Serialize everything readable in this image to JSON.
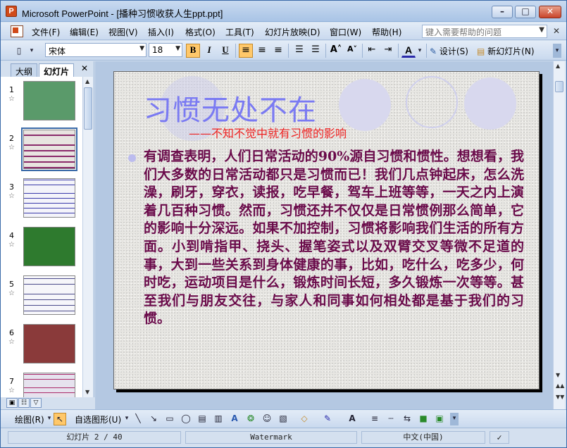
{
  "window": {
    "title": "Microsoft PowerPoint - [播种习惯收获人生ppt.ppt]",
    "app_icon_letter": "P"
  },
  "menu": {
    "items": [
      "文件(F)",
      "编辑(E)",
      "视图(V)",
      "插入(I)",
      "格式(O)",
      "工具(T)",
      "幻灯片放映(D)",
      "窗口(W)",
      "帮助(H)"
    ],
    "help_placeholder": "键入需要帮助的问题"
  },
  "toolbar": {
    "font_name": "宋体",
    "font_size": "18",
    "bold_label": "B",
    "italic_label": "I",
    "underline_label": "U",
    "design_label": "设计(S)",
    "new_slide_label": "新幻灯片(N)"
  },
  "left_pane": {
    "tab_outline": "大纲",
    "tab_slides": "幻灯片",
    "thumbnails": [
      {
        "num": "1",
        "bg": "#5a9a6a"
      },
      {
        "num": "2",
        "bg": "#e8e4e0",
        "selected": true
      },
      {
        "num": "3",
        "bg": "#f4f4fa"
      },
      {
        "num": "4",
        "bg": "#2e7a2e"
      },
      {
        "num": "5",
        "bg": "#f6f6fa"
      },
      {
        "num": "6",
        "bg": "#8a3a3a"
      },
      {
        "num": "7",
        "bg": "#e6e2ee"
      }
    ]
  },
  "slide": {
    "title": "习惯无处不在",
    "subtitle": "——不知不觉中就有习惯的影响",
    "body": "有调查表明，人们日常活动的90%源自习惯和惯性。想想看，我们大多数的日常活动都只是习惯而已！我们几点钟起床，怎么洗澡，刷牙，穿衣，读报，吃早餐，驾车上班等等，一天之内上演着几百种习惯。然而，习惯还并不仅仅是日常惯例那么简单，它的影响十分深远。如果不加控制，习惯将影响我们生活的所有方面。小到啃指甲、挠头、握笔姿式以及双臂交叉等微不足道的事，大到一些关系到身体健康的事，比如，吃什么，吃多少，何时吃，运动项目是什么，锻炼时间长短，多久锻炼一次等等。甚至我们与朋友交往，与家人和同事如何相处都是基于我们的习惯。"
  },
  "drawbar": {
    "draw_label": "绘图(R)",
    "autoshape_label": "自选图形(U)"
  },
  "status": {
    "slide_info": "幻灯片 2 / 40",
    "design": "Watermark",
    "language": "中文(中国)"
  },
  "colors": {
    "title": "#7a7af2",
    "subtitle": "#ee2222",
    "body": "#6a0a4a"
  }
}
